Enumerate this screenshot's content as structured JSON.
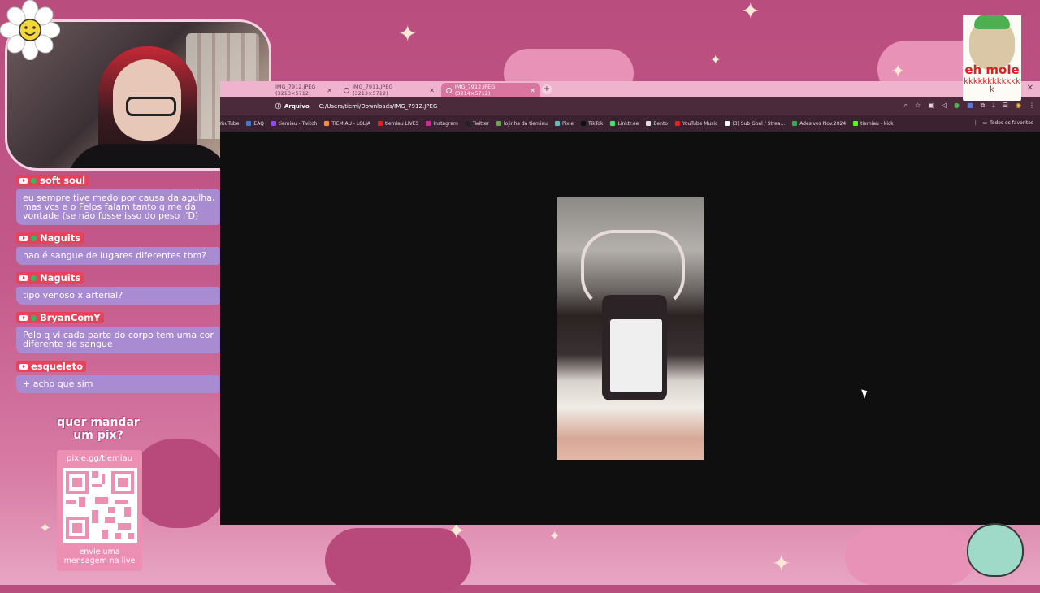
{
  "chat": {
    "messages": [
      {
        "user": "soft soul",
        "text": "eu sempre tive medo por causa da agulha, mas vcs e o Felps falam tanto q me dá vontade (se não fosse isso do peso :'D)"
      },
      {
        "user": "Naguits",
        "text": "nao é sangue de lugares diferentes tbm?"
      },
      {
        "user": "Naguits",
        "text": "tipo venoso x arterial?"
      },
      {
        "user": "BryanComY",
        "text": "Pelo q vi cada parte do corpo tem uma cor diferente de sangue"
      },
      {
        "user": "esqueleto",
        "text": "+ acho que sim"
      }
    ]
  },
  "pix": {
    "title": "quer mandar um pix?",
    "url": "pixie.gg/tiemiau",
    "footer": "envie uma mensagem na live"
  },
  "browser": {
    "tabs": [
      {
        "label": "IMG_7912.JPEG (3213×5712)"
      },
      {
        "label": "IMG_7911.JPEG (3213×5712)"
      },
      {
        "label": "IMG_7912.JPEG (3214×5712)"
      }
    ],
    "address": {
      "scheme_label": "Arquivo",
      "url": "C:/Users/tiemi/Downloads/IMG_7912.JPEG"
    },
    "bookmarks": [
      {
        "label": "YouTube",
        "color": "#e62117"
      },
      {
        "label": "EAQ",
        "color": "#3b7bd4"
      },
      {
        "label": "tiemiau - Twitch",
        "color": "#9146ff"
      },
      {
        "label": "TIEMIAU - LOLJA",
        "color": "#ff8a3d"
      },
      {
        "label": "tiemiau LIVES",
        "color": "#e62117"
      },
      {
        "label": "Instagram",
        "color": "#d6249f"
      },
      {
        "label": "Twitter",
        "color": "#222222"
      },
      {
        "label": "lojinha da tiemiau",
        "color": "#6aa84f"
      },
      {
        "label": "Pixie",
        "color": "#5bc0be"
      },
      {
        "label": "TikTok",
        "color": "#111111"
      },
      {
        "label": "Linktr.ee",
        "color": "#43e660"
      },
      {
        "label": "Bento",
        "color": "#dddddd"
      },
      {
        "label": "YouTube Music",
        "color": "#e62117"
      },
      {
        "label": "(3) Sub Goal / Strea...",
        "color": "#ffffff"
      },
      {
        "label": "Adesivos Nov.2024",
        "color": "#34a853"
      },
      {
        "label": "tiemiau - kick",
        "color": "#53fc18"
      }
    ],
    "all_favorites": "Todos os favoritos"
  },
  "meme": {
    "title": "eh mole",
    "laugh": "kkkkkkkkkkkkk"
  }
}
